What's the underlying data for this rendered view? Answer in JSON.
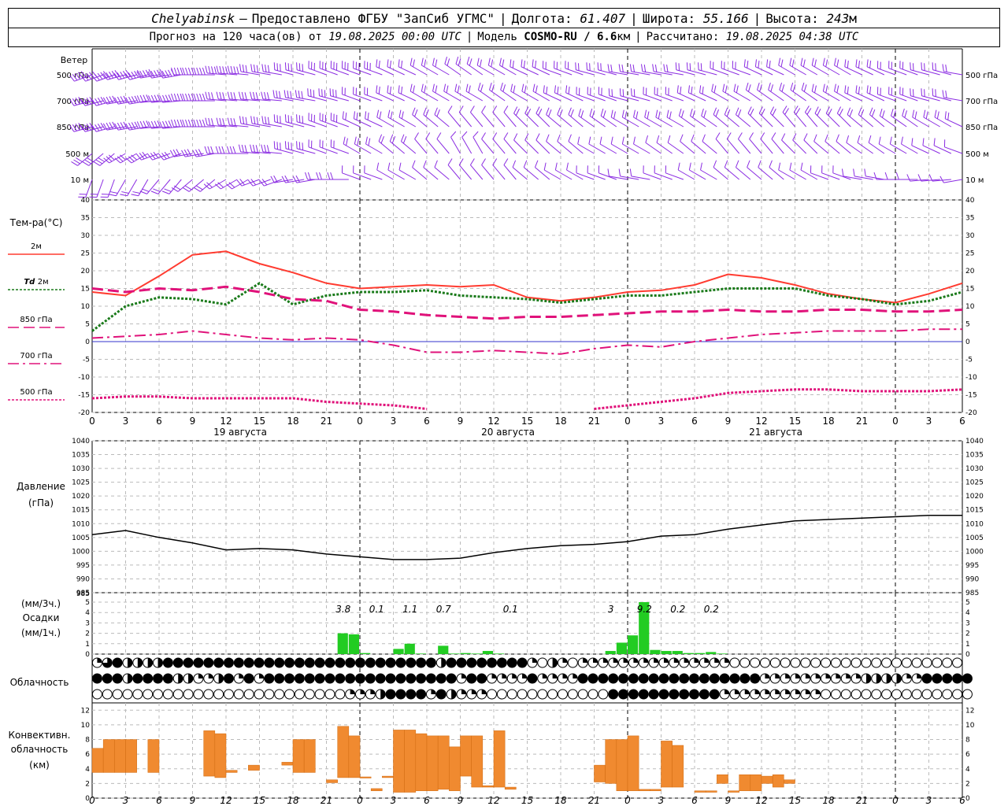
{
  "header": {
    "city": "Chelyabinsk",
    "dash": "—",
    "provider": "Предоставлено ФГБУ \"ЗапСиб УГМС\"",
    "lon_label": "Долгота:",
    "lon_value": "61.407",
    "lat_label": "Широта:",
    "lat_value": "55.166",
    "alt_label": "Высота:",
    "alt_value": "243",
    "alt_unit": "м",
    "forecast_prefix": "Прогноз на 120 часа(ов) от",
    "forecast_start": "19.08.2025 00:00 UTC",
    "model_label": "Модель",
    "model_name": "COSMO-RU / 6.6",
    "model_unit": "км",
    "calc_label": "Рассчитано:",
    "calc_time": "19.08.2025 04:38 UTC"
  },
  "chart_data": [
    {
      "type": "wind-barbs",
      "title": "Ветер",
      "levels": [
        "500 гПа",
        "700 гПа",
        "850 гПа",
        "500 м",
        "10  м"
      ],
      "color": "#8a2be2"
    },
    {
      "type": "line",
      "ylabel": "Тем-ра(°C)",
      "ylim": [
        -20,
        40
      ],
      "yticks": [
        -20,
        -15,
        -10,
        -5,
        0,
        5,
        10,
        15,
        20,
        25,
        30,
        35,
        40
      ],
      "xlabels": [
        "0",
        "3",
        "6",
        "9",
        "12",
        "15",
        "18",
        "21",
        "0",
        "3",
        "6",
        "9",
        "12",
        "15",
        "18",
        "21",
        "0",
        "3",
        "6",
        "9",
        "12",
        "15",
        "18",
        "21",
        "0",
        "3",
        "6"
      ],
      "day_labels": [
        {
          "hour": 12,
          "text": "19 августа"
        },
        {
          "hour": 36,
          "text": "20 августа"
        },
        {
          "hour": 60,
          "text": "21 августа"
        }
      ],
      "x": [
        0,
        3,
        6,
        9,
        12,
        15,
        18,
        21,
        24,
        27,
        30,
        33,
        36,
        39,
        42,
        45,
        48,
        51,
        54,
        57,
        60,
        63,
        66,
        69,
        72,
        75,
        78
      ],
      "series": [
        {
          "name": "2м",
          "color": "#ff3b30",
          "dash": "solid",
          "values": [
            14,
            13,
            18.5,
            24.5,
            25.5,
            22,
            19.5,
            16.5,
            15,
            15.5,
            16,
            15.5,
            16,
            12.5,
            11.5,
            12.5,
            14,
            14.5,
            16,
            19,
            18,
            16,
            13.5,
            12,
            11,
            13.5,
            16.5
          ]
        },
        {
          "name": "Td  2м",
          "color": "#1a7a1a",
          "dash": "dotted",
          "values": [
            3,
            10,
            12.5,
            12,
            10.5,
            16.5,
            10.5,
            13,
            14,
            14,
            14.5,
            13,
            12.5,
            12,
            11,
            12,
            13,
            13,
            14,
            15,
            15,
            15,
            13,
            12,
            10.5,
            11.5,
            14
          ]
        },
        {
          "name": "850 гПа",
          "color": "#e0127a",
          "dash": "dashed",
          "values": [
            15,
            14,
            15,
            14.5,
            15.5,
            14,
            12,
            11.5,
            9,
            8.5,
            7.5,
            7,
            6.5,
            7,
            7,
            7.5,
            8,
            8.5,
            8.5,
            9,
            8.5,
            8.5,
            9,
            9,
            8.5,
            8.5,
            9
          ]
        },
        {
          "name": "700 гПа",
          "color": "#e0127a",
          "dash": "dashdot",
          "values": [
            1,
            1.5,
            2,
            3,
            2,
            1,
            0.5,
            1,
            0.5,
            -1,
            -3,
            -3,
            -2.5,
            -3,
            -3.5,
            -2,
            -1,
            -1.5,
            0,
            1,
            2,
            2.5,
            3,
            3,
            3,
            3.5,
            3.5
          ]
        },
        {
          "name": "500 гПа",
          "color": "#e0127a",
          "dash": "dotted",
          "values": [
            -16,
            -15.5,
            -15.5,
            -16,
            -16,
            -16,
            -16,
            -17,
            -17.5,
            -18,
            -19,
            null,
            null,
            null,
            null,
            -19,
            -18,
            -17,
            -16,
            -14.5,
            -14,
            -13.5,
            -13.5,
            -14,
            -14,
            -14,
            -13.5
          ]
        }
      ]
    },
    {
      "type": "line",
      "ylabel": "Давление",
      "ylabel_unit": "(гПа)",
      "ylim": [
        985,
        1040
      ],
      "yticks": [
        985,
        990,
        995,
        1000,
        1005,
        1010,
        1015,
        1020,
        1025,
        1030,
        1035,
        1040
      ],
      "x": [
        0,
        3,
        6,
        9,
        12,
        15,
        18,
        21,
        24,
        27,
        30,
        33,
        36,
        39,
        42,
        45,
        48,
        51,
        54,
        57,
        60,
        63,
        66,
        69,
        72,
        75,
        78
      ],
      "series": [
        {
          "name": "",
          "color": "#000000",
          "values": [
            1006,
            1007.5,
            1005,
            1003,
            1000.5,
            1001,
            1000.5,
            999,
            998,
            997,
            997,
            997.5,
            999.5,
            1001,
            1002,
            1002.5,
            1003.5,
            1005.5,
            1006,
            1008,
            1009.5,
            1011,
            1011.5,
            1012,
            1012.5,
            1013,
            1013
          ]
        }
      ]
    },
    {
      "type": "bar",
      "ylabel": "(мм/3ч.)",
      "ylabel2": "Осадки",
      "ylabel3": "(мм/1ч.)",
      "ylim": [
        0,
        5
      ],
      "yticks": [
        0,
        1,
        2,
        3,
        4,
        5
      ],
      "bar_color": "#22cc22",
      "hours": [
        22,
        23,
        24,
        25,
        26,
        27,
        28,
        29,
        30,
        31,
        32,
        33,
        34,
        35,
        36,
        37,
        46,
        47,
        48,
        49,
        50,
        51,
        52,
        53,
        54,
        55,
        56
      ],
      "values": [
        2.0,
        1.9,
        0.1,
        0.0,
        0.0,
        0.5,
        1.0,
        0.05,
        0.0,
        0.8,
        0.05,
        0.1,
        0.05,
        0.3,
        0.05,
        0.0,
        0.3,
        1.1,
        1.8,
        5.0,
        0.4,
        0.3,
        0.3,
        0.1,
        0.1,
        0.2,
        0.05
      ],
      "annotations": [
        {
          "hour": 22.5,
          "text": "3.8"
        },
        {
          "hour": 25.5,
          "text": "0.1"
        },
        {
          "hour": 28.5,
          "text": "1.1"
        },
        {
          "hour": 31.5,
          "text": "0.7"
        },
        {
          "hour": 37.5,
          "text": "0.1"
        },
        {
          "hour": 46.5,
          "text": "3"
        },
        {
          "hour": 49.5,
          "text": "9.2"
        },
        {
          "hour": 52.5,
          "text": "0.2"
        },
        {
          "hour": 55.5,
          "text": "0.2"
        }
      ]
    },
    {
      "type": "table",
      "ylabel": "Облачность",
      "rows": [
        "qtfhhhhfffffffffffffffffffffffffffhffffffffqehqeqqqqqqqqqqqqqqqeeeeeeeeeeeeeeeeeeeeeee",
        "fffhffffhhqqhfqfqfffffffffffffffffffqffqqqqfqqqqffffffffffffffffffqqqqqqqqqqhhhhqqfffff",
        "eeeeeeeeeeeeeeeeeeeeeeeeeqqqhffffqfhqqqeeeeeeeeeeeefffffffffffqqqqqqqqqqeeeeeeeeeeeeeee"
      ],
      "legend": "e=clear, q=quarter, h=half, t=three-quarter, f=overcast"
    },
    {
      "type": "bar",
      "ylabel": "Конвективн.",
      "ylabel2": "облачность",
      "ylabel3": "(км)",
      "ylim": [
        0,
        13
      ],
      "yticks": [
        0,
        2,
        4,
        6,
        8,
        10,
        12
      ],
      "bar_color": "#f08a30",
      "bars": [
        {
          "hour": 0,
          "bottom": 3.5,
          "top": 6.8
        },
        {
          "hour": 1,
          "bottom": 3.5,
          "top": 8
        },
        {
          "hour": 2,
          "bottom": 3.5,
          "top": 8
        },
        {
          "hour": 3,
          "bottom": 3.5,
          "top": 8
        },
        {
          "hour": 5,
          "bottom": 3.5,
          "top": 8
        },
        {
          "hour": 10,
          "bottom": 3,
          "top": 9.2
        },
        {
          "hour": 11,
          "bottom": 2.8,
          "top": 8.8
        },
        {
          "hour": 12,
          "bottom": 3.5,
          "top": 3.8
        },
        {
          "hour": 14,
          "bottom": 3.8,
          "top": 4.5
        },
        {
          "hour": 17,
          "bottom": 4.5,
          "top": 4.9
        },
        {
          "hour": 18,
          "bottom": 3.5,
          "top": 8
        },
        {
          "hour": 19,
          "bottom": 3.5,
          "top": 8
        },
        {
          "hour": 21,
          "bottom": 2.1,
          "top": 2.5
        },
        {
          "hour": 22,
          "bottom": 2.8,
          "top": 9.8
        },
        {
          "hour": 23,
          "bottom": 2.8,
          "top": 8.5
        },
        {
          "hour": 24,
          "bottom": 2.8,
          "top": 2.9
        },
        {
          "hour": 25,
          "bottom": 1,
          "top": 1.3
        },
        {
          "hour": 26,
          "bottom": 2.8,
          "top": 3
        },
        {
          "hour": 27,
          "bottom": 0.8,
          "top": 9.3
        },
        {
          "hour": 28,
          "bottom": 0.8,
          "top": 9.3
        },
        {
          "hour": 29,
          "bottom": 1,
          "top": 8.8
        },
        {
          "hour": 30,
          "bottom": 1,
          "top": 8.5
        },
        {
          "hour": 31,
          "bottom": 1.2,
          "top": 8.5
        },
        {
          "hour": 32,
          "bottom": 1,
          "top": 7
        },
        {
          "hour": 33,
          "bottom": 3,
          "top": 8.5
        },
        {
          "hour": 34,
          "bottom": 1.5,
          "top": 8.5
        },
        {
          "hour": 35,
          "bottom": 1.5,
          "top": 1.7
        },
        {
          "hour": 36,
          "bottom": 1.5,
          "top": 9.2
        },
        {
          "hour": 37,
          "bottom": 1.2,
          "top": 1.5
        },
        {
          "hour": 45,
          "bottom": 2.2,
          "top": 4.5
        },
        {
          "hour": 46,
          "bottom": 2,
          "top": 8
        },
        {
          "hour": 47,
          "bottom": 1,
          "top": 8
        },
        {
          "hour": 48,
          "bottom": 1,
          "top": 8.5
        },
        {
          "hour": 49,
          "bottom": 1,
          "top": 1.2
        },
        {
          "hour": 50,
          "bottom": 1,
          "top": 1.2
        },
        {
          "hour": 51,
          "bottom": 1.5,
          "top": 7.8
        },
        {
          "hour": 52,
          "bottom": 1.5,
          "top": 7.2
        },
        {
          "hour": 54,
          "bottom": 0.8,
          "top": 1
        },
        {
          "hour": 55,
          "bottom": 0.8,
          "top": 1
        },
        {
          "hour": 56,
          "bottom": 2,
          "top": 3.2
        },
        {
          "hour": 57,
          "bottom": 0.8,
          "top": 1
        },
        {
          "hour": 58,
          "bottom": 1,
          "top": 3.2
        },
        {
          "hour": 59,
          "bottom": 1,
          "top": 3.2
        },
        {
          "hour": 60,
          "bottom": 2,
          "top": 3
        },
        {
          "hour": 61,
          "bottom": 1.5,
          "top": 3.2
        },
        {
          "hour": 62,
          "bottom": 2,
          "top": 2.5
        }
      ]
    }
  ],
  "legend": {
    "t2m": "2м",
    "td_prefix": "Td",
    "td_suffix": "2м",
    "t850": "850 гПа",
    "t700": "700 гПа",
    "t500": "500 гПа"
  }
}
